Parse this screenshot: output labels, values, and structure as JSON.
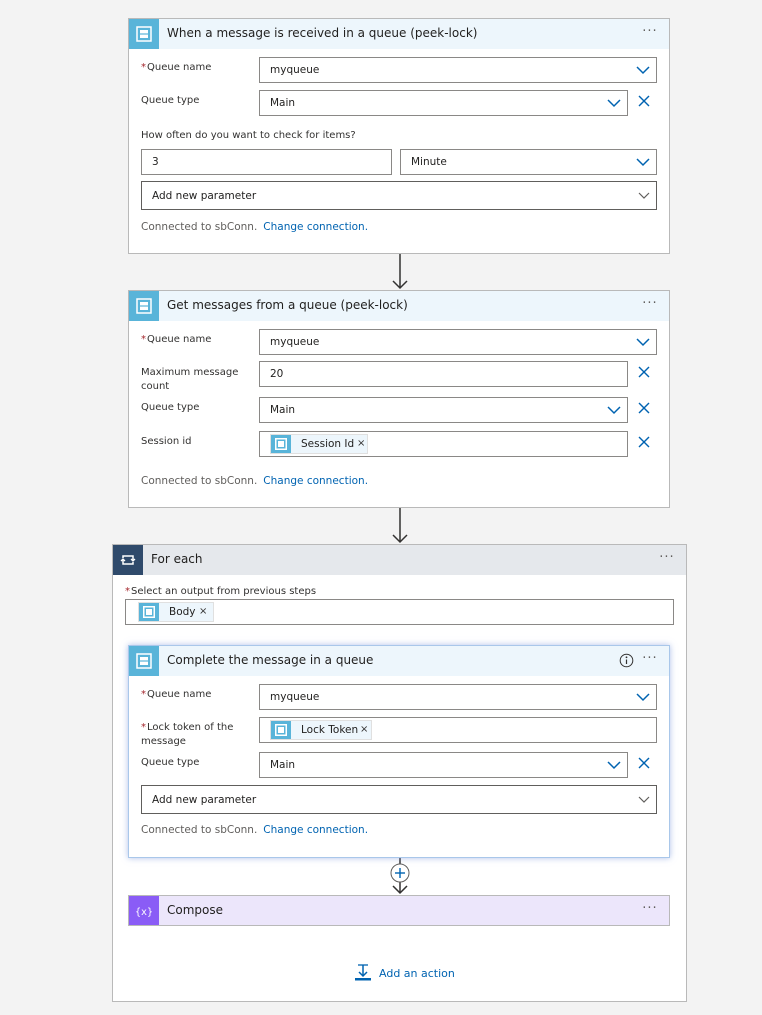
{
  "card1": {
    "title": "When a message is received in a queue (peek-lock)",
    "queue_name_label": "Queue name",
    "queue_name_value": "myqueue",
    "queue_type_label": "Queue type",
    "queue_type_value": "Main",
    "frequency_label": "How often do you want to check for items?",
    "interval_value": "3",
    "frequency_value": "Minute",
    "add_param_label": "Add new parameter",
    "connected_text": "Connected to sbConn.",
    "change_connection": "Change connection."
  },
  "card2": {
    "title": "Get messages from a queue (peek-lock)",
    "queue_name_label": "Queue name",
    "queue_name_value": "myqueue",
    "max_count_label": "Maximum message count",
    "max_count_value": "20",
    "queue_type_label": "Queue type",
    "queue_type_value": "Main",
    "session_label": "Session id",
    "session_token": "Session Id",
    "connected_text": "Connected to sbConn.",
    "change_connection": "Change connection."
  },
  "foreach": {
    "title": "For each",
    "select_label": "Select an output from previous steps",
    "body_token": "Body",
    "add_action": "Add an action"
  },
  "card3": {
    "title": "Complete the message in a queue",
    "queue_name_label": "Queue name",
    "queue_name_value": "myqueue",
    "lock_token_label_1": "Lock token of the",
    "lock_token_label_2": "message",
    "lock_token_value": "Lock Token",
    "queue_type_label": "Queue type",
    "queue_type_value": "Main",
    "add_param_label": "Add new parameter",
    "connected_text": "Connected to sbConn.",
    "change_connection": "Change connection."
  },
  "compose": {
    "title": "Compose"
  },
  "common": {
    "more": "···",
    "token_remove": "×"
  },
  "colors": {
    "service_bus": "#59b4d9",
    "compose": "#8a5cf6",
    "foreach": "#2f4a6b",
    "link": "#0063b1"
  }
}
